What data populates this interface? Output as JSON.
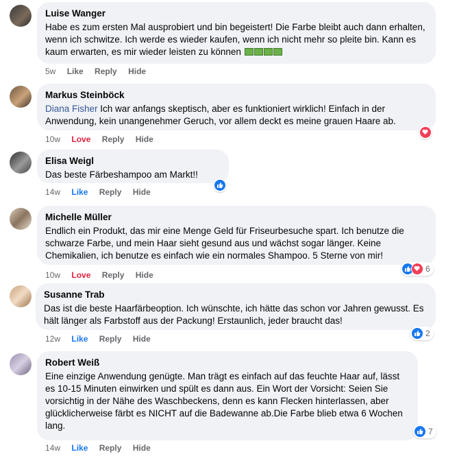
{
  "actions": {
    "like": "Like",
    "love": "Love",
    "reply": "Reply",
    "hide": "Hide"
  },
  "colors": {
    "bubble": "#f0f2f5",
    "like_blue": "#1877f2",
    "love_red": "#f33e58",
    "meta_gray": "#65676b",
    "mention": "#385898"
  },
  "comments": [
    {
      "name": "Luise Wanger",
      "text": "Habe es zum ersten Mal ausprobiert und bin begeistert! Die Farbe bleibt auch dann erhalten, wenn ich schwitze. Ich werde es wieder kaufen, wenn ich nicht mehr so pleite bin. Kann es kaum erwarten, es mir wieder leisten zu können",
      "emoji": "money-with-wings-emoji",
      "time": "5w",
      "reaction_label": "Like"
    },
    {
      "name": "Markus Steinböck",
      "mention": "Diana Fisher",
      "text": "Ich war anfangs skeptisch, aber es funktioniert wirklich! Einfach in der Anwendung, kein unangenehmer Geruch, vor allem deckt es meine grauen Haare ab.",
      "time": "10w",
      "reaction_label": "Love",
      "reactions": [
        "love-icon"
      ]
    },
    {
      "name": "Elisa Weigl",
      "text": "Das beste Färbeshampoo am Markt!!",
      "time": "14w",
      "reaction_label": "Like",
      "reactions": [
        "like-icon"
      ]
    },
    {
      "name": "Michelle Müller",
      "text": "Endlich ein Produkt, das mir eine Menge Geld für Friseurbesuche spart. Ich benutze die schwarze Farbe, und mein Haar sieht gesund aus und wächst sogar länger. Keine Chemikalien, ich benutze es einfach wie ein normales Shampoo. 5 Sterne von mir!",
      "time": "10w",
      "reaction_label": "Love",
      "reactions": [
        "like-icon",
        "love-icon"
      ],
      "reaction_count": "6"
    },
    {
      "name": "Susanne Trab",
      "text": "Das ist die beste Haarfärbeoption. Ich wünschte, ich hätte das schon vor Jahren gewusst. Es hält länger als Farbstoff aus der Packung! Erstaunlich, jeder braucht das!",
      "time": "12w",
      "reaction_label": "Like",
      "reactions": [
        "like-icon"
      ],
      "reaction_count": "2"
    },
    {
      "name": "Robert Weiß",
      "text": "Eine einzige Anwendung genügte. Man trägt es einfach auf das feuchte Haar auf, lässt es 10-15 Minuten einwirken und spült es dann aus. Ein Wort der Vorsicht: Seien Sie vorsichtig in der Nähe des Waschbeckens, denn es kann Flecken hinterlassen, aber glücklicherweise färbt es NICHT auf die Badewanne ab.Die Farbe blieb etwa 6 Wochen lang.",
      "time": "14w",
      "reaction_label": "Like",
      "reactions": [
        "like-icon"
      ],
      "reaction_count": "7"
    }
  ]
}
